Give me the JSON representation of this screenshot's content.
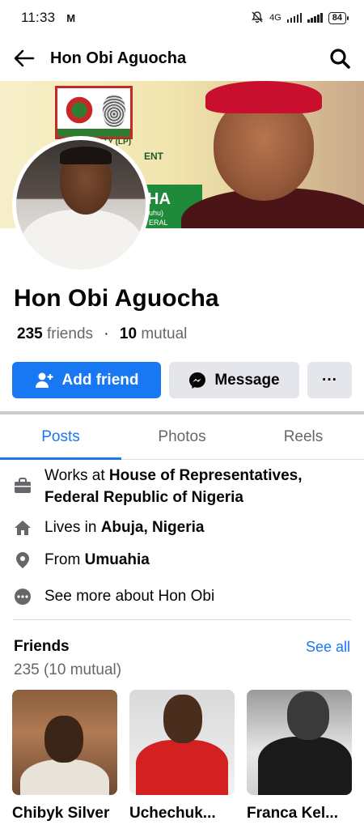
{
  "status_bar": {
    "time": "11:33",
    "carrier_badge": "M",
    "network": "4G",
    "battery": "84"
  },
  "header": {
    "title": "Hon Obi Aguocha"
  },
  "cover": {
    "party_text": "RTY (LP)",
    "ment_text": "ENT",
    "ha_text": "HA",
    "sub1_text": "uhu)",
    "sub2_text": "ERAL"
  },
  "profile": {
    "name": "Hon Obi Aguocha",
    "friends_count": "235",
    "friends_label": "friends",
    "mutual_count": "10",
    "mutual_label": "mutual"
  },
  "actions": {
    "add_friend": "Add friend",
    "message": "Message",
    "more": "···"
  },
  "tabs": [
    {
      "label": "Posts"
    },
    {
      "label": "Photos"
    },
    {
      "label": "Reels"
    }
  ],
  "intro": {
    "work_prefix": "Works at ",
    "work_place_line1": "House of Representatives,",
    "work_place_line2": "Federal Republic of Nigeria",
    "lives_prefix": "Lives in ",
    "lives_place": "Abuja, Nigeria",
    "from_prefix": "From ",
    "from_place": "Umuahia",
    "see_more": "See more about Hon Obi"
  },
  "friends": {
    "title": "Friends",
    "see_all": "See all",
    "count": "235 (10 mutual)",
    "items": [
      {
        "name": "Chibyk Silver"
      },
      {
        "name": "Uchechuk..."
      },
      {
        "name": "Franca Kel..."
      }
    ]
  },
  "colors": {
    "brand_blue": "#1877f2",
    "secondary_button": "#e4e6eb",
    "muted_text": "#65676b"
  }
}
